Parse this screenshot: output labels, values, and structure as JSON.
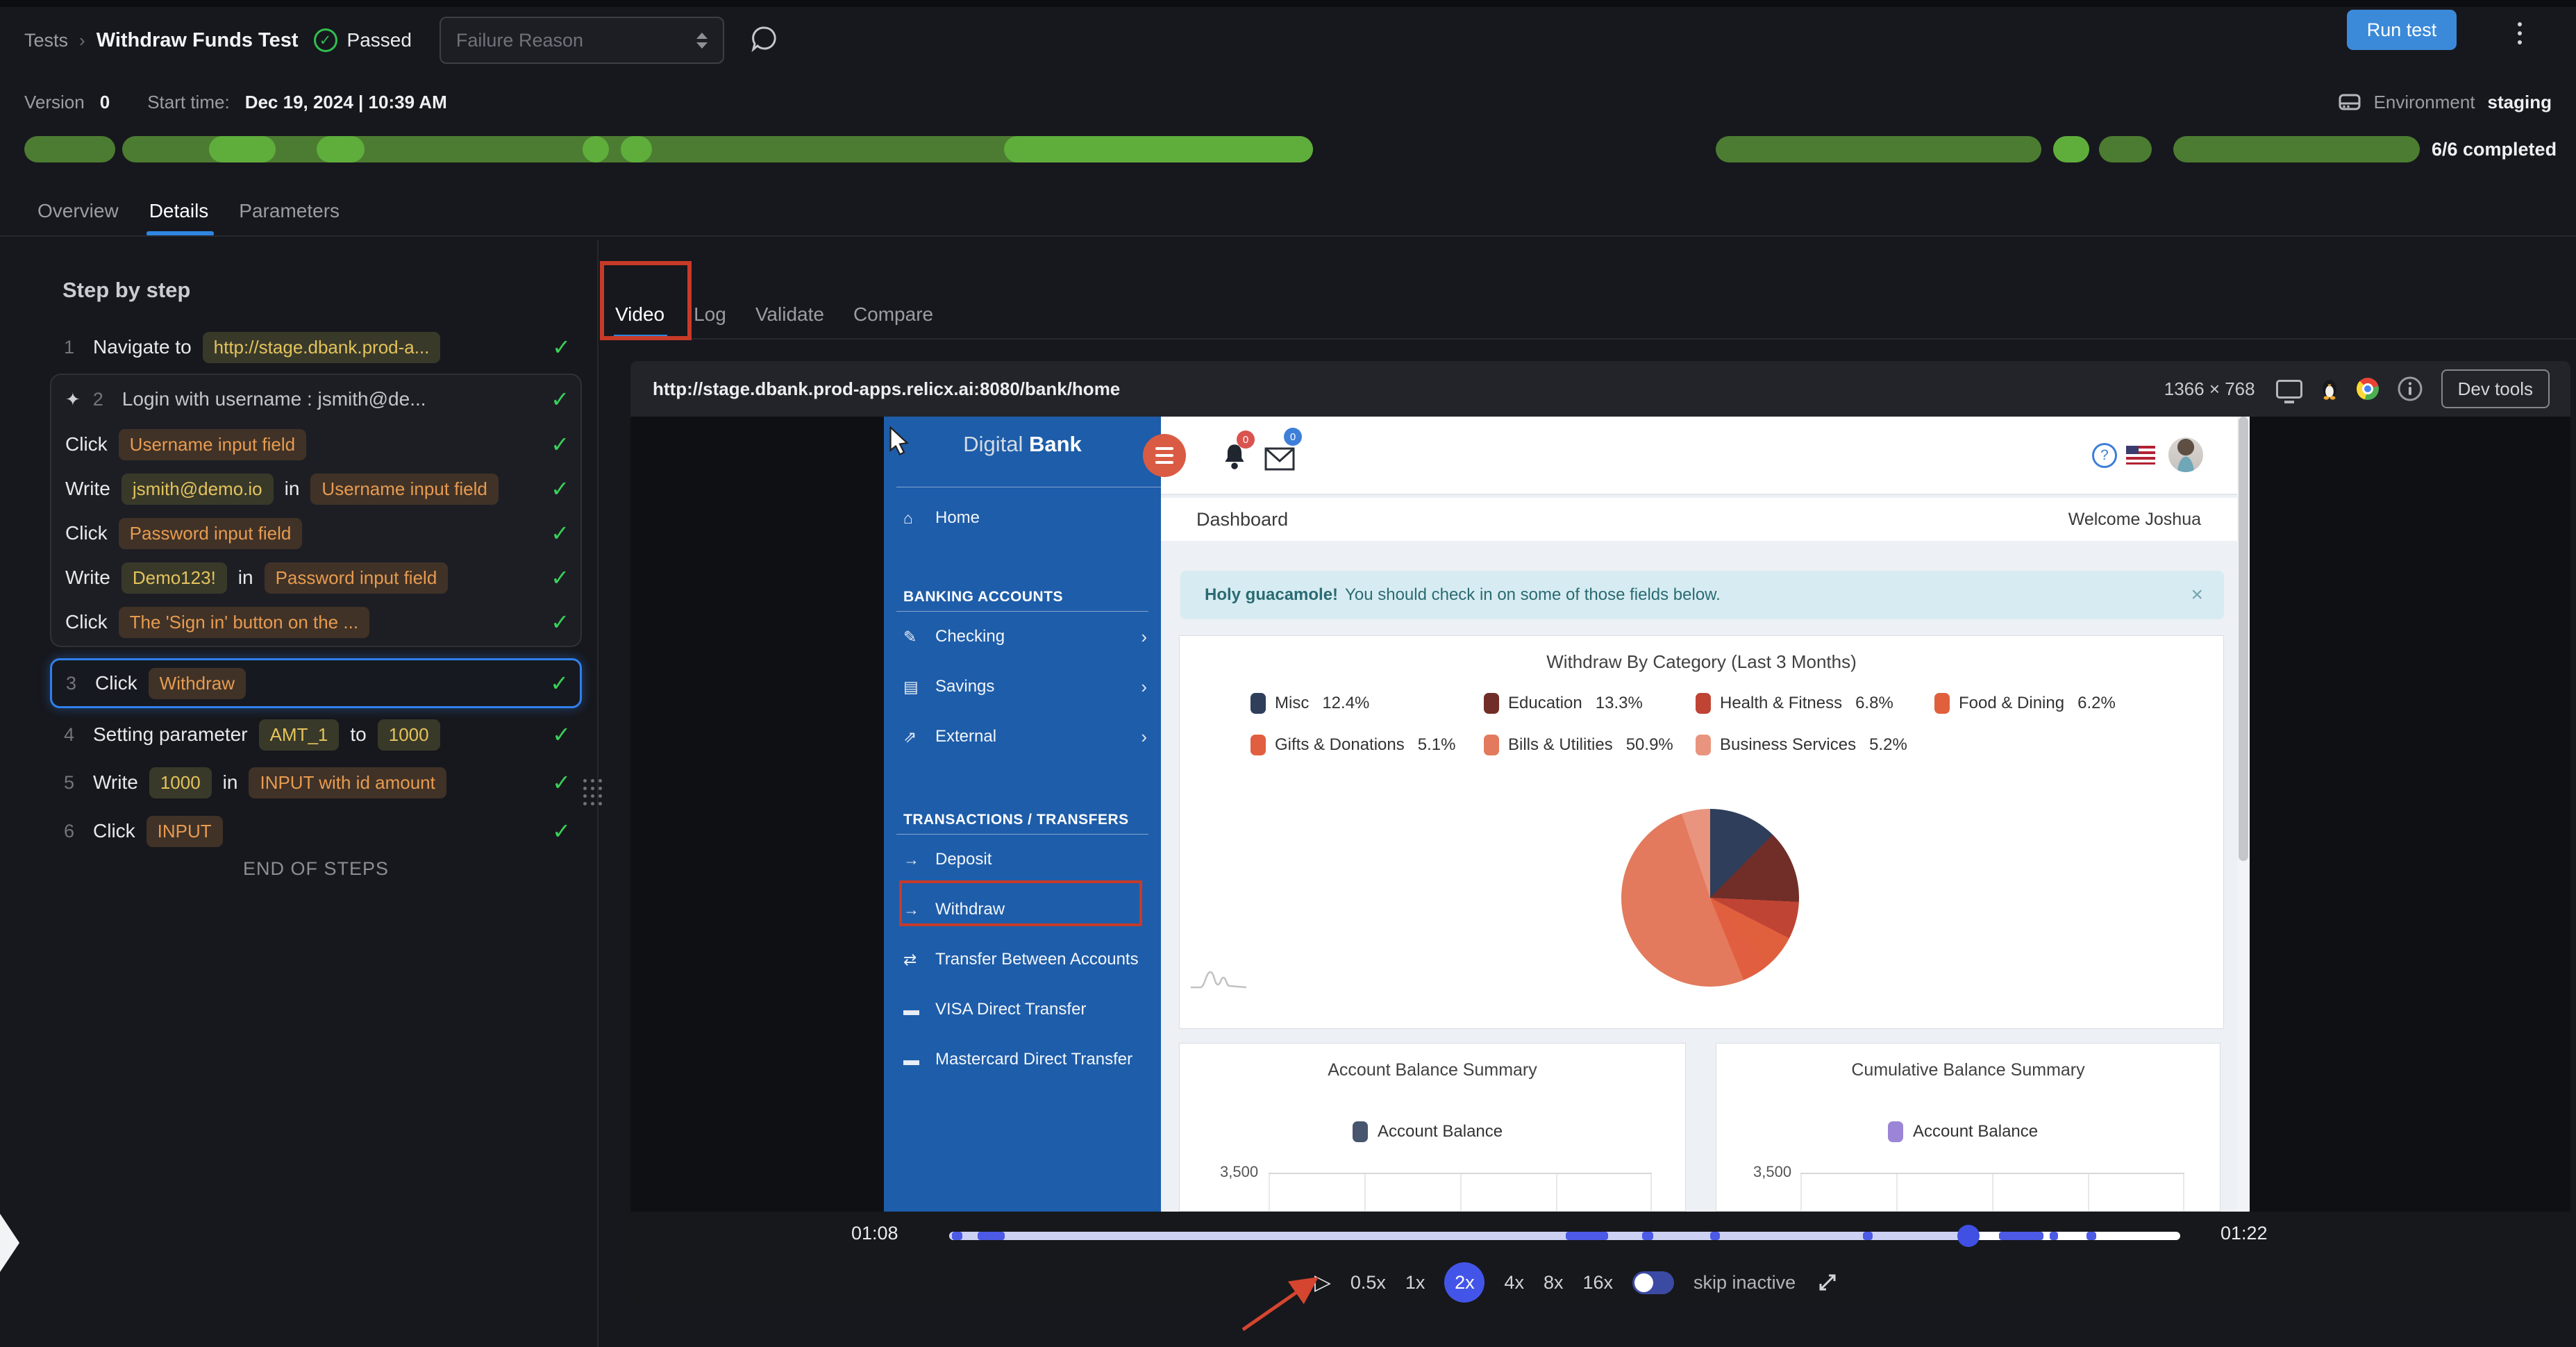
{
  "icons": {
    "check": "✓",
    "sparkle": "✦",
    "caret": "›",
    "play": "▷",
    "home": "⌂",
    "checking": "✎",
    "savings": "▤",
    "external": "⇗",
    "deposit": "→",
    "withdraw": "→",
    "transfer": "⇄",
    "visa": "▬",
    "mastercard": "▬"
  },
  "header": {
    "breadcrumb_root": "Tests",
    "breadcrumb_sep": "›",
    "test_name": "Withdraw Funds Test",
    "status": "Passed",
    "failure_reason_placeholder": "Failure Reason",
    "run_button": "Run test"
  },
  "meta": {
    "version_label": "Version",
    "version_value": "0",
    "start_label": "Start time:",
    "start_value": "Dec 19, 2024 | 10:39 AM",
    "environment_label": "Environment",
    "environment_value": "staging"
  },
  "progress": {
    "completed": "6/6 completed",
    "segments": [
      {
        "x": 0,
        "w": 3.8
      },
      {
        "x": 4.1,
        "w": 49.7
      },
      {
        "x": 70.6,
        "w": 13.6
      },
      {
        "x": 86.6,
        "w": 2.2
      },
      {
        "x": 89.7,
        "w": 10.3
      }
    ],
    "highlights": [
      {
        "x": 7.7,
        "w": 2.8
      },
      {
        "x": 12.2,
        "w": 2.0
      },
      {
        "x": 23.3,
        "w": 1.1
      },
      {
        "x": 24.9,
        "w": 1.3
      },
      {
        "x": 40.9,
        "w": 12.9
      },
      {
        "x": 84.7,
        "w": 1.5
      }
    ]
  },
  "tabs": [
    {
      "label": "Overview",
      "active": false
    },
    {
      "label": "Details",
      "active": true
    },
    {
      "label": "Parameters",
      "active": false
    }
  ],
  "steps": {
    "title": "Step by step",
    "end_label": "END OF STEPS",
    "items": [
      {
        "type": "step",
        "num": "1",
        "tokens": [
          [
            "text",
            "Navigate to"
          ],
          [
            "val",
            "http://stage.dbank.prod-a..."
          ]
        ]
      },
      {
        "type": "group",
        "header": {
          "num": "2",
          "ai": true,
          "tokens": [
            [
              "plain",
              "Login with username : jsmith@de..."
            ]
          ]
        },
        "children": [
          {
            "tokens": [
              [
                "text",
                "Click"
              ],
              [
                "target",
                "Username input field"
              ]
            ]
          },
          {
            "tokens": [
              [
                "text",
                "Write"
              ],
              [
                "val",
                "jsmith@demo.io"
              ],
              [
                "text",
                "in"
              ],
              [
                "target",
                "Username input field"
              ]
            ]
          },
          {
            "tokens": [
              [
                "text",
                "Click"
              ],
              [
                "target",
                "Password input field"
              ]
            ]
          },
          {
            "tokens": [
              [
                "text",
                "Write"
              ],
              [
                "val",
                "Demo123!"
              ],
              [
                "text",
                "in"
              ],
              [
                "target",
                "Password input field"
              ]
            ]
          },
          {
            "tokens": [
              [
                "text",
                "Click"
              ],
              [
                "target",
                "The 'Sign in' button on the ..."
              ]
            ]
          }
        ]
      },
      {
        "type": "step",
        "num": "3",
        "selected": true,
        "tokens": [
          [
            "text",
            "Click"
          ],
          [
            "target",
            "Withdraw"
          ]
        ]
      },
      {
        "type": "step",
        "num": "4",
        "tokens": [
          [
            "text",
            "Setting parameter"
          ],
          [
            "val",
            "AMT_1"
          ],
          [
            "text",
            "to"
          ],
          [
            "val",
            "1000"
          ]
        ]
      },
      {
        "type": "step",
        "num": "5",
        "tokens": [
          [
            "text",
            "Write"
          ],
          [
            "val",
            "1000"
          ],
          [
            "text",
            "in"
          ],
          [
            "target",
            "INPUT with id amount"
          ]
        ]
      },
      {
        "type": "step",
        "num": "6",
        "tokens": [
          [
            "text",
            "Click"
          ],
          [
            "target",
            "INPUT"
          ]
        ]
      }
    ]
  },
  "video_panel": {
    "tabs": [
      {
        "label": "Video",
        "active": true
      },
      {
        "label": "Log",
        "active": false
      },
      {
        "label": "Validate",
        "active": false
      },
      {
        "label": "Compare",
        "active": false
      }
    ],
    "url": "http://stage.dbank.prod-apps.relicx.ai:8080/bank/home",
    "resolution": "1366 × 768",
    "devtools_button": "Dev tools"
  },
  "player": {
    "current_time": "01:08",
    "total_time": "01:22",
    "playhead_pct": 82.8,
    "markers": [
      {
        "x": 0.2,
        "w": 0.9
      },
      {
        "x": 2.3,
        "w": 2.2
      },
      {
        "x": 50.1,
        "w": 3.4
      },
      {
        "x": 56.3,
        "w": 0.9
      },
      {
        "x": 61.8,
        "w": 0.8
      },
      {
        "x": 74.2,
        "w": 0.8
      },
      {
        "x": 85.3,
        "w": 3.6
      },
      {
        "x": 89.4,
        "w": 0.7
      },
      {
        "x": 92.4,
        "w": 0.8
      }
    ],
    "speeds": [
      "0.5x",
      "1x",
      "2x",
      "4x",
      "8x",
      "16x"
    ],
    "active_speed": "2x",
    "skip_label": "skip inactive"
  },
  "bank": {
    "logo_light": "Digital",
    "logo_bold": "Bank",
    "bell_badge": "0",
    "mail_badge": "0",
    "help_glyph": "?",
    "dashboard_title": "Dashboard",
    "welcome": "Welcome Joshua",
    "alert": {
      "bold": "Holy guacamole!",
      "text": "You should check in on some of those fields below.",
      "close": "×"
    },
    "sidebar": {
      "sections": [
        {
          "header": null,
          "items": [
            {
              "icon": "home",
              "label": "Home",
              "caret": false
            }
          ]
        },
        {
          "header": "BANKING ACCOUNTS",
          "items": [
            {
              "icon": "checking",
              "label": "Checking",
              "caret": true
            },
            {
              "icon": "savings",
              "label": "Savings",
              "caret": true
            },
            {
              "icon": "external",
              "label": "External",
              "caret": true
            }
          ]
        },
        {
          "header": "TRANSACTIONS / TRANSFERS",
          "items": [
            {
              "icon": "deposit",
              "label": "Deposit",
              "caret": false
            },
            {
              "icon": "withdraw",
              "label": "Withdraw",
              "caret": false,
              "highlighted": true
            },
            {
              "icon": "transfer",
              "label": "Transfer Between Accounts",
              "caret": false
            },
            {
              "icon": "visa",
              "label": "VISA Direct Transfer",
              "caret": false
            },
            {
              "icon": "mastercard",
              "label": "Mastercard Direct Transfer",
              "caret": false
            }
          ]
        }
      ]
    },
    "chart_data": {
      "pie": {
        "type": "pie",
        "title": "Withdraw By Category (Last 3 Months)",
        "labels": [
          "Misc",
          "Education",
          "Health & Fitness",
          "Food & Dining",
          "Gifts & Donations",
          "Bills & Utilities",
          "Business Services"
        ],
        "values": [
          12.4,
          13.3,
          6.8,
          6.2,
          5.1,
          50.9,
          5.2
        ],
        "value_labels": [
          "12.4%",
          "13.3%",
          "6.8%",
          "6.2%",
          "5.1%",
          "50.9%",
          "5.2%"
        ],
        "colors": [
          "#2e3e5b",
          "#712e28",
          "#bf4434",
          "#e0603e",
          "#e15f40",
          "#e37a5d",
          "#e9947e"
        ],
        "legend_rows": [
          [
            0,
            1,
            2,
            3
          ],
          [
            4,
            5,
            6
          ]
        ]
      },
      "account_balance": {
        "type": "bar",
        "title": "Account Balance Summary",
        "legend": "Account Balance",
        "legend_color": "#47556e",
        "ytick": "3,500"
      },
      "cumulative_balance": {
        "type": "bar",
        "title": "Cumulative Balance Summary",
        "legend": "Account Balance",
        "legend_color": "#9b85d6",
        "ytick": "3,500"
      }
    }
  }
}
